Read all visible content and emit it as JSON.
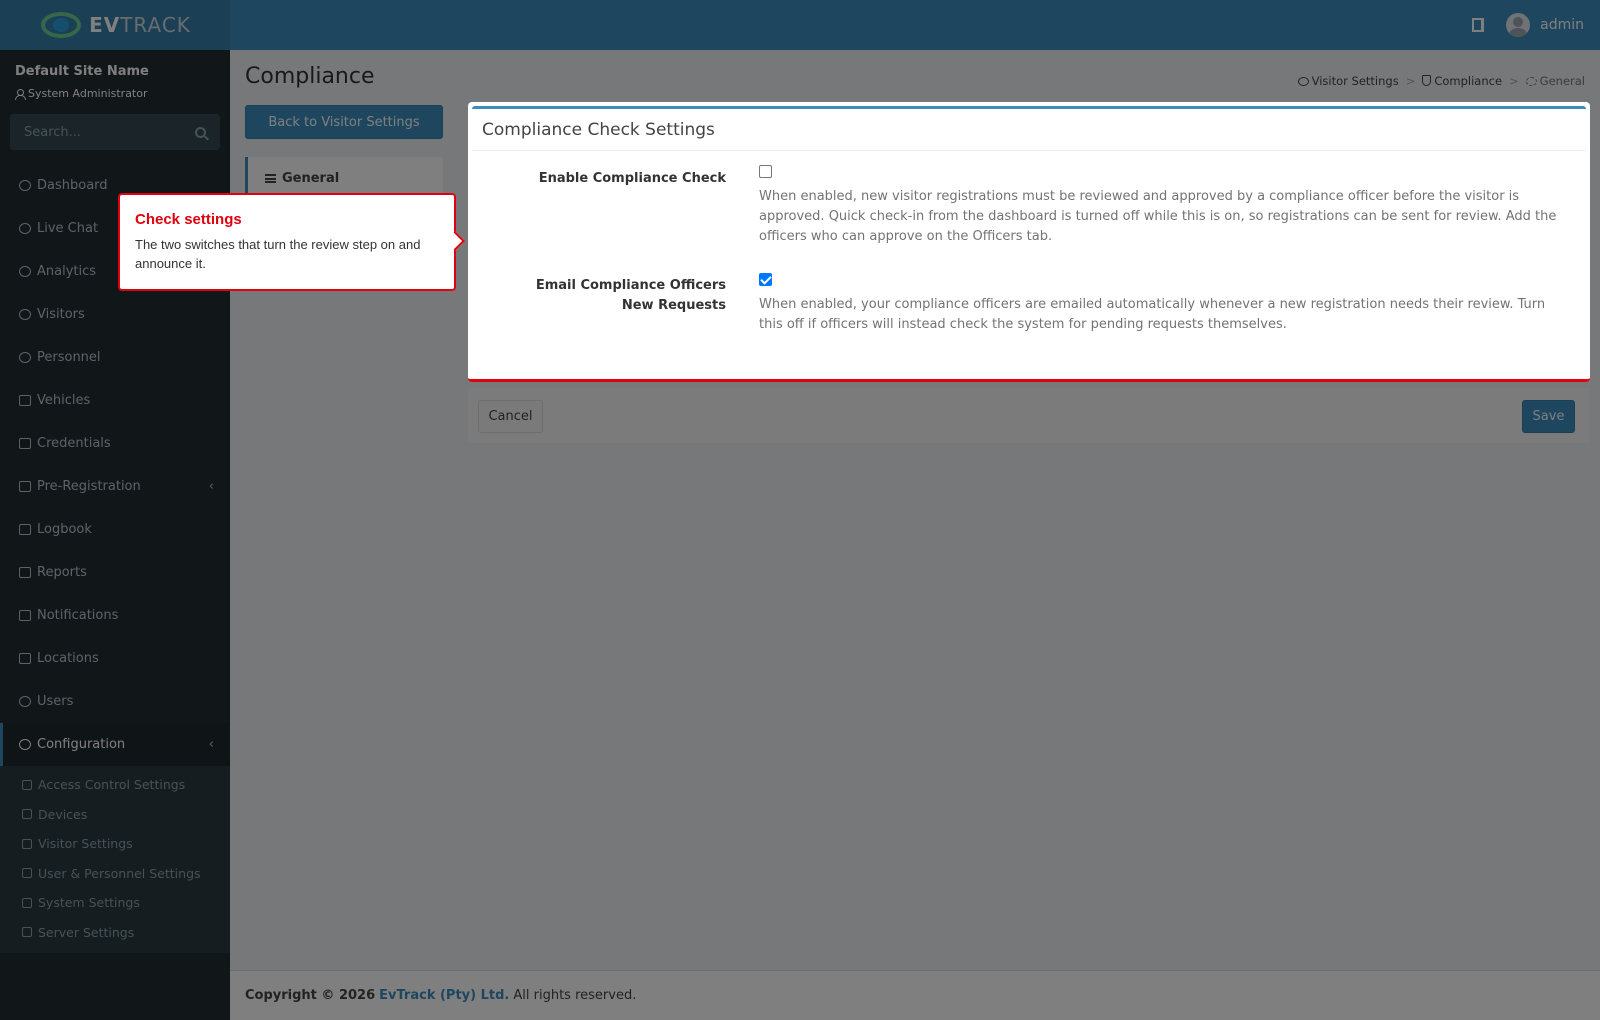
{
  "app": {
    "logo_prefix": "EV",
    "logo_suffix": "TRACK"
  },
  "topbar": {
    "user_name": "admin"
  },
  "sidebar": {
    "site_name": "Default Site Name",
    "site_role": "System Administrator",
    "search_placeholder": "Search...",
    "items": [
      {
        "label": "Dashboard",
        "icon": "dashboard-icon"
      },
      {
        "label": "Live Chat",
        "icon": "headset-icon"
      },
      {
        "label": "Analytics",
        "icon": "analytics-icon"
      },
      {
        "label": "Visitors",
        "icon": "eye-icon"
      },
      {
        "label": "Personnel",
        "icon": "personnel-icon"
      },
      {
        "label": "Vehicles",
        "icon": "car-icon"
      },
      {
        "label": "Credentials",
        "icon": "badge-icon"
      },
      {
        "label": "Pre-Registration",
        "icon": "arrows-icon",
        "chevron": "‹"
      },
      {
        "label": "Logbook",
        "icon": "book-icon"
      },
      {
        "label": "Reports",
        "icon": "chart-icon"
      },
      {
        "label": "Notifications",
        "icon": "bell-icon"
      },
      {
        "label": "Locations",
        "icon": "map-icon"
      },
      {
        "label": "Users",
        "icon": "users-icon"
      },
      {
        "label": "Configuration",
        "icon": "gear-icon",
        "chevron": "‹"
      }
    ],
    "submenu": [
      {
        "label": "Access Control Settings",
        "icon": "lock-icon"
      },
      {
        "label": "Devices",
        "icon": "device-icon"
      },
      {
        "label": "Visitor Settings",
        "icon": "eye-icon"
      },
      {
        "label": "User & Personnel Settings",
        "icon": "users-icon"
      },
      {
        "label": "System Settings",
        "icon": "sliders-icon"
      },
      {
        "label": "Server Settings",
        "icon": "server-icon"
      }
    ]
  },
  "page": {
    "title": "Compliance",
    "breadcrumb": [
      "Visitor Settings",
      "Compliance",
      "General"
    ],
    "back_button": "Back to Visitor Settings",
    "tab_general": "General"
  },
  "panel": {
    "title": "Compliance Check Settings",
    "fields": [
      {
        "label": "Enable Compliance Check",
        "checked": false,
        "help": "When enabled, new visitor registrations must be reviewed and approved by a compliance officer before the visitor is approved. Quick check-in from the dashboard is turned off while this is on, so registrations can be sent for review. Add the officers who can approve on the Officers tab."
      },
      {
        "label": "Email Compliance Officers New Requests",
        "checked": true,
        "help": "When enabled, your compliance officers are emailed automatically whenever a new registration needs their review. Turn this off if officers will instead check the system for pending requests themselves."
      }
    ],
    "cancel": "Cancel",
    "save": "Save"
  },
  "footer": {
    "prefix": "Copyright © 2026",
    "brand": "EvTrack (Pty) Ltd.",
    "suffix": "All rights reserved."
  },
  "tooltip": {
    "title": "Check settings",
    "body": "The two switches that turn the review step on and announce it."
  },
  "colors": {
    "accent": "#3c8dbc",
    "highlight": "#e0000e",
    "sidebar": "#222d32"
  }
}
